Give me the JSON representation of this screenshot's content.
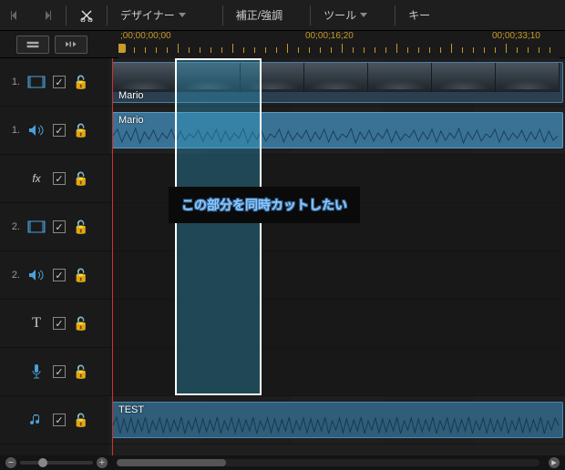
{
  "toolbar": {
    "designer_label": "デザイナー",
    "correction_label": "補正/強調",
    "tool_label": "ツール",
    "key_label": "キー"
  },
  "ruler": {
    "t0": ";00;00;00;00",
    "t1": "00;00;16;20",
    "t2": "00;00;33;10"
  },
  "tracks": {
    "video1_num": "1.",
    "audio1_num": "1.",
    "video2_num": "2.",
    "audio2_num": "2.",
    "clip_video_label": "Mario",
    "clip_audio_label": "Mario",
    "clip_music_label": "TEST"
  },
  "annotation_text": "この部分を同時カットしたい"
}
